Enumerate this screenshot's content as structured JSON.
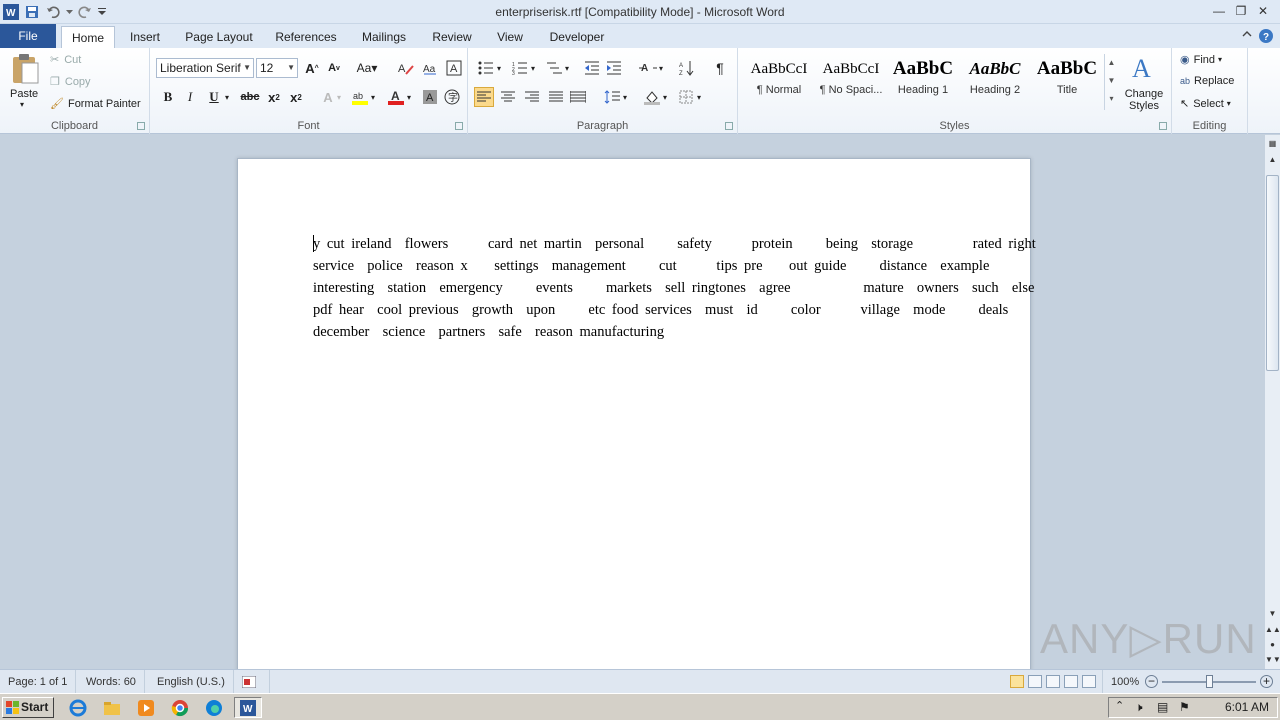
{
  "window": {
    "title": "enterpriserisk.rtf [Compatibility Mode]  -  Microsoft Word"
  },
  "tabs": [
    {
      "label": "File"
    },
    {
      "label": "Home"
    },
    {
      "label": "Insert"
    },
    {
      "label": "Page Layout"
    },
    {
      "label": "References"
    },
    {
      "label": "Mailings"
    },
    {
      "label": "Review"
    },
    {
      "label": "View"
    },
    {
      "label": "Developer"
    }
  ],
  "ribbon": {
    "clipboard": {
      "group_label": "Clipboard",
      "paste": "Paste",
      "cut": "Cut",
      "copy": "Copy",
      "format_painter": "Format Painter"
    },
    "font": {
      "group_label": "Font",
      "font_name": "Liberation Serif",
      "font_size": "12"
    },
    "paragraph": {
      "group_label": "Paragraph"
    },
    "styles": {
      "group_label": "Styles",
      "items": [
        {
          "preview": "AaBbCcI",
          "name": "¶ Normal"
        },
        {
          "preview": "AaBbCcI",
          "name": "¶ No Spaci..."
        },
        {
          "preview": "AaBbC",
          "name": "Heading 1"
        },
        {
          "preview": "AaBbC",
          "name": "Heading 2"
        },
        {
          "preview": "AaBbC",
          "name": "Title"
        }
      ],
      "change_styles": "Change Styles"
    },
    "editing": {
      "group_label": "Editing",
      "find": "Find",
      "replace": "Replace",
      "select": "Select"
    }
  },
  "document": {
    "lines": [
      "y cut ireland  flowers      card net martin  personal     safety      protein     being  storage         rated right",
      "service  police  reason x    settings  management     cut      tips pre    out guide     distance  example",
      "interesting  station  emergency     events     markets  sell ringtones  agree           mature  owners  such  else",
      "pdf hear  cool previous  growth  upon     etc food services  must  id     color      village  mode     deals",
      "december  science  partners  safe  reason manufacturing"
    ]
  },
  "statusbar": {
    "page": "Page: 1 of 1",
    "words": "Words: 60",
    "language": "English (U.S.)",
    "zoom": "100%"
  },
  "taskbar": {
    "start": "Start",
    "time": "6:01 AM"
  },
  "watermark": "ANY▷RUN",
  "colors": {
    "file_tab": "#2b579a",
    "ribbon_bg": "#ffffff",
    "doc_bg": "#c5d1de"
  }
}
